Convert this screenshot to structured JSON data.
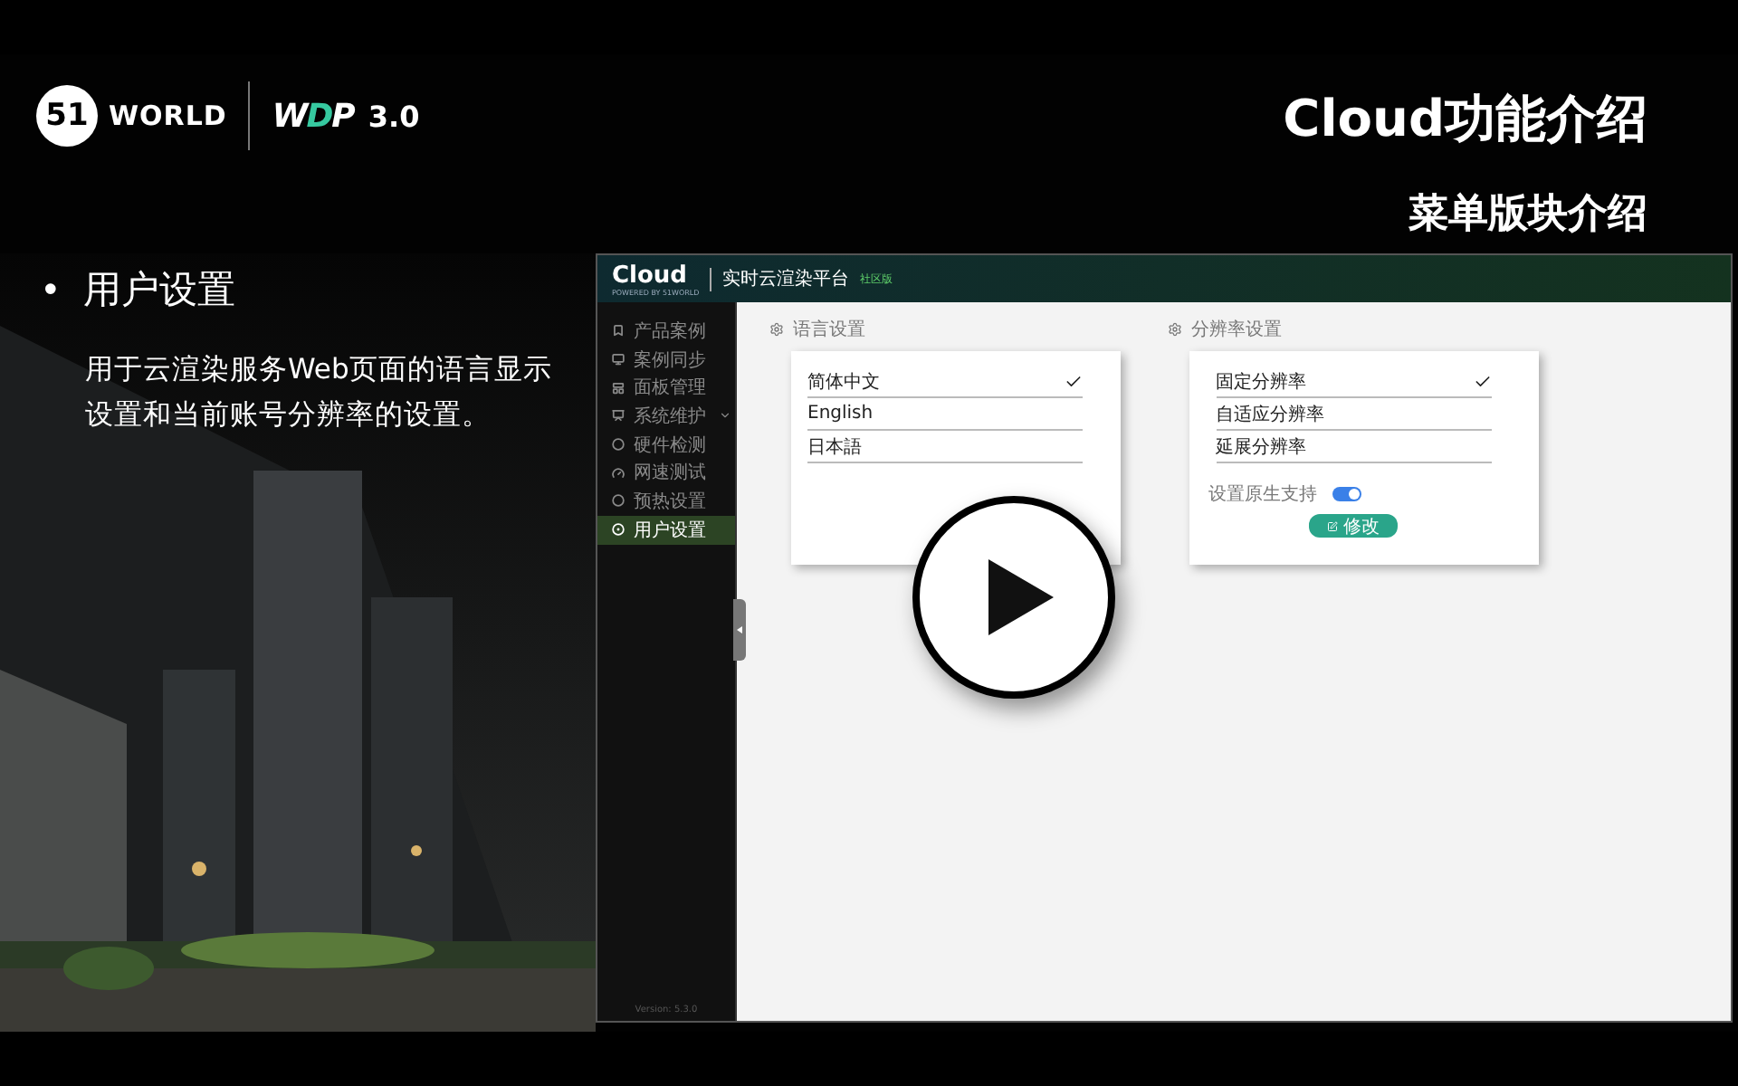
{
  "logo": {
    "mark": "51",
    "brand": "WORLD",
    "product_start": "W",
    "product_mid": "D",
    "product_end": "P",
    "version": "3.0"
  },
  "title": "Cloud功能介绍",
  "subtitle": "菜单版块介绍",
  "bullet": {
    "marker": "•",
    "heading": "用户设置",
    "description": "用于云渲染服务Web页面的语言显示设置和当前账号分辨率的设置。"
  },
  "app": {
    "logo": "Cloud",
    "logo_tagline": "POWERED BY 51WORLD",
    "title": "实时云渲染平台",
    "edition": "社区版",
    "sidebar": {
      "items": [
        {
          "label": "产品案例",
          "expandable": false,
          "selected": false
        },
        {
          "label": "案例同步",
          "expandable": false,
          "selected": false
        },
        {
          "label": "面板管理",
          "expandable": false,
          "selected": false
        },
        {
          "label": "系统维护",
          "expandable": true,
          "selected": false
        },
        {
          "label": "硬件检测",
          "expandable": false,
          "selected": false
        },
        {
          "label": "网速测试",
          "expandable": false,
          "selected": false
        },
        {
          "label": "预热设置",
          "expandable": false,
          "selected": false
        },
        {
          "label": "用户设置",
          "expandable": false,
          "selected": true
        }
      ],
      "version": "Version: 5.3.0"
    },
    "language": {
      "title": "语言设置",
      "options": [
        {
          "label": "简体中文",
          "selected": true
        },
        {
          "label": "English",
          "selected": false
        },
        {
          "label": "日本語",
          "selected": false
        }
      ]
    },
    "resolution": {
      "title": "分辨率设置",
      "options": [
        {
          "label": "固定分辨率",
          "selected": true
        },
        {
          "label": "自适应分辨率",
          "selected": false
        },
        {
          "label": "延展分辨率",
          "selected": false
        }
      ],
      "native_support": {
        "label": "设置原生支持",
        "on": true
      },
      "button": "修改"
    }
  }
}
